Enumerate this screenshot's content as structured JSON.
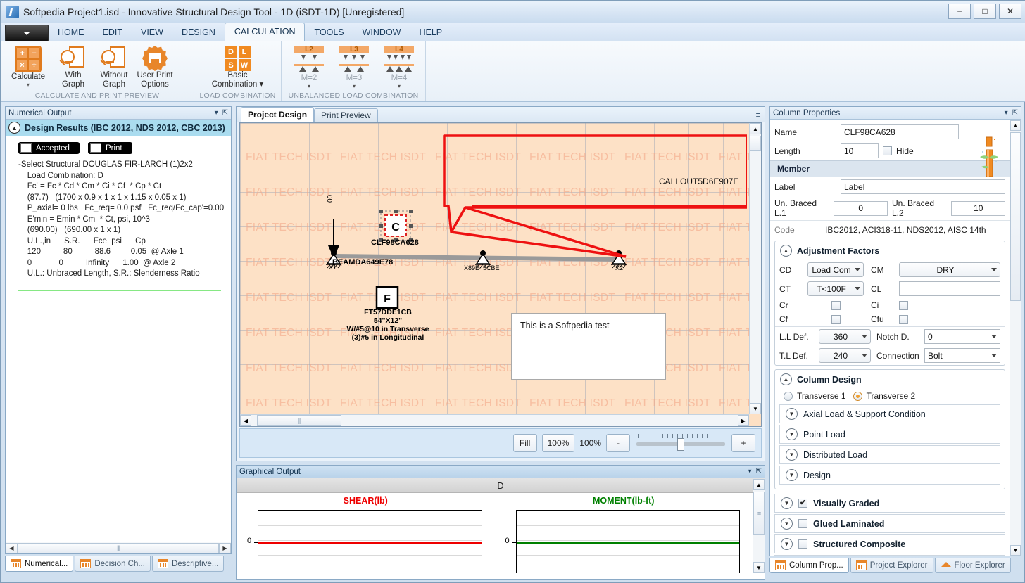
{
  "window": {
    "title": "Softpedia Project1.isd - Innovative Structural Design Tool - 1D (iSDT-1D) [Unregistered]",
    "minimize": "−",
    "maximize": "□",
    "close": "✕"
  },
  "menu": {
    "tabs": [
      {
        "label": "HOME",
        "active": false
      },
      {
        "label": "EDIT",
        "active": false
      },
      {
        "label": "VIEW",
        "active": false
      },
      {
        "label": "DESIGN",
        "active": false
      },
      {
        "label": "CALCULATION",
        "active": true
      },
      {
        "label": "TOOLS",
        "active": false
      },
      {
        "label": "WINDOW",
        "active": false
      },
      {
        "label": "HELP",
        "active": false
      }
    ]
  },
  "ribbon": {
    "groups": [
      {
        "title": "CALCULATE AND PRINT PREVIEW",
        "items": [
          {
            "label": "Calculate",
            "icon": "calculator-icon",
            "dropdown": "▾"
          },
          {
            "label": "With\nGraph",
            "icon": "document-zoom-icon",
            "dropdown": ""
          },
          {
            "label": "Without\nGraph",
            "icon": "document-zoom-icon",
            "dropdown": ""
          },
          {
            "label": "User Print\nOptions",
            "icon": "gear-printer-icon",
            "dropdown": ""
          }
        ]
      },
      {
        "title": "LOAD COMBINATION",
        "items": [
          {
            "label": "Basic\nCombination ▾",
            "icon": "dlsw-icon",
            "keys": [
              "D",
              "L",
              "S",
              "W"
            ]
          }
        ]
      },
      {
        "title": "UNBALANCED LOAD COMBINATION",
        "items": [
          {
            "label": "M=2",
            "icon": "unbalanced-load-icon",
            "badge": "L2",
            "arrows": 2,
            "tris": 2,
            "dropdown": "▾"
          },
          {
            "label": "M=3",
            "icon": "unbalanced-load-icon",
            "badge": "L3",
            "arrows": 3,
            "tris": 2,
            "dropdown": "▾"
          },
          {
            "label": "M=4",
            "icon": "unbalanced-load-icon",
            "badge": "L4",
            "arrows": 4,
            "tris": 3,
            "dropdown": "▾"
          }
        ]
      }
    ]
  },
  "left_panel": {
    "title": "Numerical Output",
    "collapse_icon": "▾",
    "pin_icon": "⇱",
    "results_header": "Design Results (IBC 2012, NDS 2012, CBC 2013)",
    "buttons": [
      {
        "label": "Accepted",
        "checked": false
      },
      {
        "label": "Print",
        "checked": false
      }
    ],
    "report_title": "-Select Structural DOUGLAS FIR-LARCH (1)2x2",
    "report_lines": [
      "    Load Combination: D",
      "    Fc' = Fc * Cd * Cm * Ci * Cf  * Cp * Ct",
      "    (87.7)   (1700 x 0.9 x 1 x 1 x 1.15 x 0.05 x 1)",
      "    P_axial= 0 lbs   Fc_req= 0.0 psf   Fc_req/Fc_cap'=0.00",
      "    E'min = Emin * Cm  * Ct, psi, 10^3",
      "    (690.00)   (690.00 x 1 x 1)",
      "    U.L.,in      S.R.      Fce, psi      Cp",
      "    120          80          88.6         0.05  @ Axle 1",
      "    0            0          Infinity      1.00  @ Axle 2",
      "    U.L.: Unbraced Length, S.R.: Slenderness Ratio"
    ],
    "tabs": [
      {
        "label": "Numerical...",
        "active": true,
        "icon": "numerical-tab-icon"
      },
      {
        "label": "Decision Ch...",
        "active": false,
        "icon": "decision-chart-tab-icon"
      },
      {
        "label": "Descriptive...",
        "active": false,
        "icon": "descriptive-tab-icon"
      }
    ]
  },
  "center_panel": {
    "tabs": [
      {
        "label": "Project Design",
        "active": true
      },
      {
        "label": "Print Preview",
        "active": false
      }
    ],
    "watermark_text": "FIAT TECH ISDT",
    "canvas": {
      "column_marker": "C",
      "column_label": "CLF98CA628",
      "beam_label": "BEAMDA649E78",
      "support_left": "X1",
      "support_mid": "X89E45CBE",
      "support_right": "X2",
      "load_value": "00",
      "footing_marker": "F",
      "footing_label": "FT57DDE1CB",
      "footing_size": "54\"X12\"",
      "footing_rebar_1": "W/#5@10 in Transverse",
      "footing_rebar_2": "(3)#5 in Longitudinal",
      "callout_label": "CALLOUT5D6E907E",
      "note_text": "This is a Softpedia test",
      "callout_color": "#ee1111"
    },
    "zoom_bar": {
      "fill_label": "Fill",
      "zoom_preset": "100%",
      "zoom_value": "100%",
      "minus": "-",
      "plus": "+"
    }
  },
  "graph_panel": {
    "title": "Graphical Output",
    "collapse_icon": "▾",
    "pin_icon": "⇱",
    "combination": "D",
    "chart_data": [
      {
        "type": "line",
        "title": "SHEAR(lb)",
        "color": "#ee0000",
        "x": [
          0,
          1
        ],
        "values": [
          0,
          0
        ],
        "ylabel": "",
        "xlabel": "",
        "ticklabels": [
          "0"
        ],
        "grid": true
      },
      {
        "type": "line",
        "title": "MOMENT(lb-ft)",
        "color": "#008000",
        "x": [
          0,
          1
        ],
        "values": [
          0,
          0
        ],
        "ylabel": "",
        "xlabel": "",
        "ticklabels": [
          "0"
        ],
        "grid": true
      }
    ]
  },
  "right_panel": {
    "title": "Column Properties",
    "collapse_icon": "▾",
    "pin_icon": "⇱",
    "name_label": "Name",
    "name_value": "CLF98CA628",
    "length_label": "Length",
    "length_value": "10",
    "hide_label": "Hide",
    "hide_checked": false,
    "member_header": "Member",
    "label_label": "Label",
    "label_value": "Label",
    "unbraced1_label": "Un. Braced L.1",
    "unbraced1_value": "0",
    "unbraced2_label": "Un. Braced L.2",
    "unbraced2_value": "10",
    "code_label": "Code",
    "code_value": "IBC2012, ACI318-11, NDS2012, AISC 14th",
    "adjustment_header": "Adjustment Factors",
    "factors": [
      {
        "label": "CD",
        "type": "select",
        "value": "Load Com"
      },
      {
        "label": "CM",
        "type": "select",
        "value": "DRY"
      },
      {
        "label": "CT",
        "type": "select",
        "value": "T<100F"
      },
      {
        "label": "CL",
        "type": "text",
        "value": ""
      },
      {
        "label": "Cr",
        "type": "check",
        "value": ""
      },
      {
        "label": "Ci",
        "type": "check",
        "value": ""
      },
      {
        "label": "Cf",
        "type": "check",
        "value": ""
      },
      {
        "label": "Cfu",
        "type": "check",
        "value": ""
      }
    ],
    "ll_def_label": "L.L Def.",
    "ll_def_value": "360",
    "notch_label": "Notch D.",
    "notch_value": "0",
    "tl_def_label": "T.L Def.",
    "tl_def_value": "240",
    "connection_label": "Connection",
    "connection_value": "Bolt",
    "column_design_header": "Column Design",
    "transverse": [
      {
        "label": "Transverse 1",
        "selected": false
      },
      {
        "label": "Transverse 2",
        "selected": true
      }
    ],
    "design_sections": [
      "Axial Load & Support Condition",
      "Point Load",
      "Distributed Load",
      "Design"
    ],
    "material_sections": [
      {
        "label": "Visually Graded",
        "checked": true
      },
      {
        "label": "Glued Laminated",
        "checked": false
      },
      {
        "label": "Structured Composite",
        "checked": false
      }
    ],
    "tabs": [
      {
        "label": "Column Prop...",
        "active": true,
        "icon": "column-properties-tab-icon"
      },
      {
        "label": "Project Explorer",
        "active": false,
        "icon": "project-explorer-tab-icon"
      },
      {
        "label": "Floor Explorer",
        "active": false,
        "icon": "floor-explorer-tab-icon"
      }
    ]
  }
}
